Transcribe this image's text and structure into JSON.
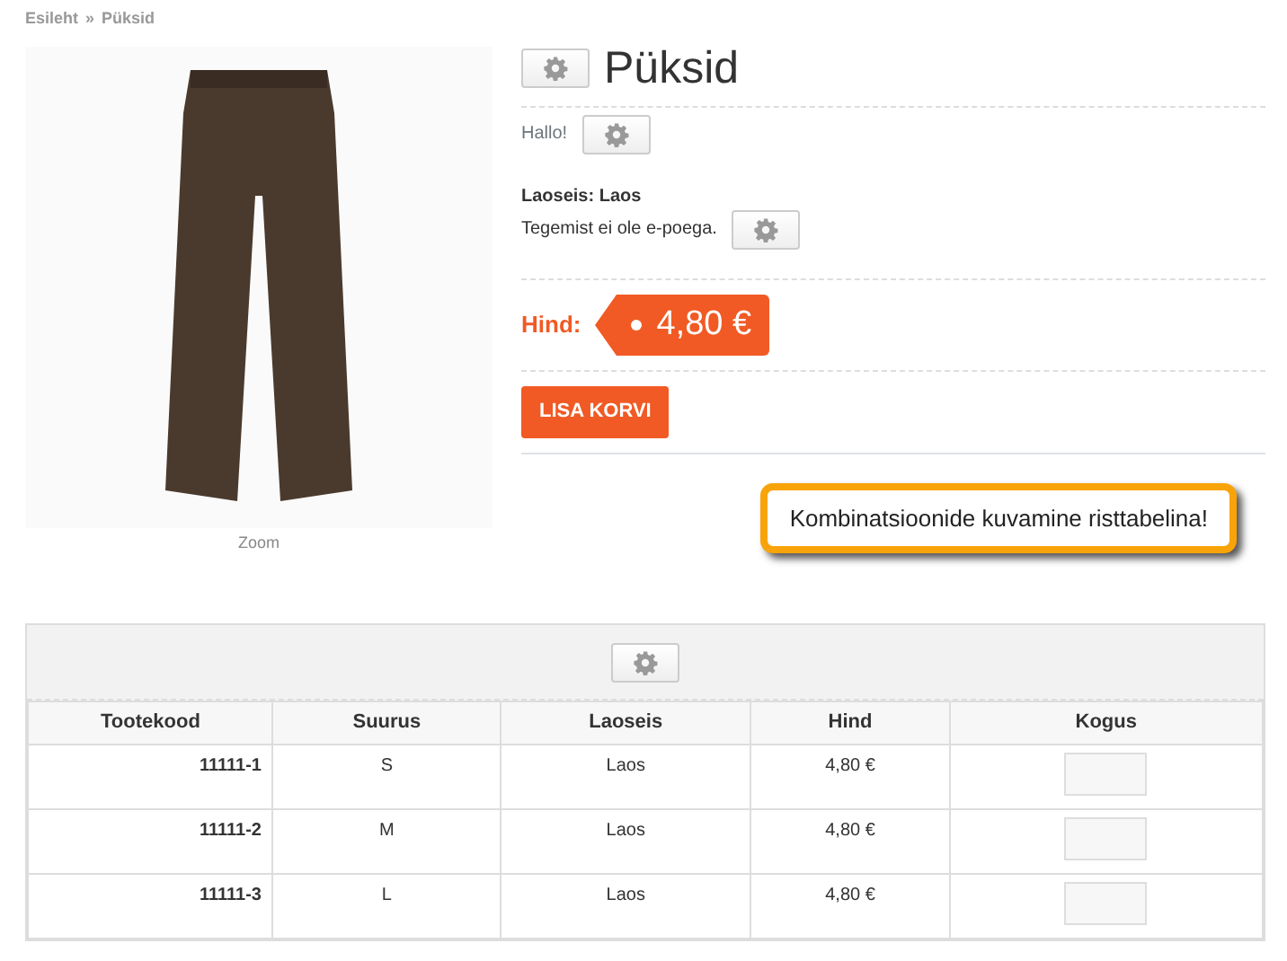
{
  "breadcrumb": [
    "Esileht",
    "»",
    "Püksid"
  ],
  "product": {
    "image_caption": "Zoom",
    "title": "Püksid",
    "short_text": "Hallo!",
    "stock_label": "Laoseis:",
    "stock_value": "Laos",
    "note": "Tegemist ei ole e-poega.",
    "price_label": "Hind:",
    "price": "4,80 €",
    "cart_button": "LISA KORVI"
  },
  "callout": "Kombinatsioonide kuvamine risttabelina!",
  "table": {
    "columns": [
      "Tootekood",
      "Suurus",
      "Laoseis",
      "Hind",
      "Kogus"
    ],
    "rows": [
      {
        "code": "11111-1",
        "size": "S",
        "stock": "Laos",
        "price": "4,80 €"
      },
      {
        "code": "11111-2",
        "size": "M",
        "stock": "Laos",
        "price": "4,80 €"
      },
      {
        "code": "11111-3",
        "size": "L",
        "stock": "Laos",
        "price": "4,80 €"
      }
    ]
  }
}
